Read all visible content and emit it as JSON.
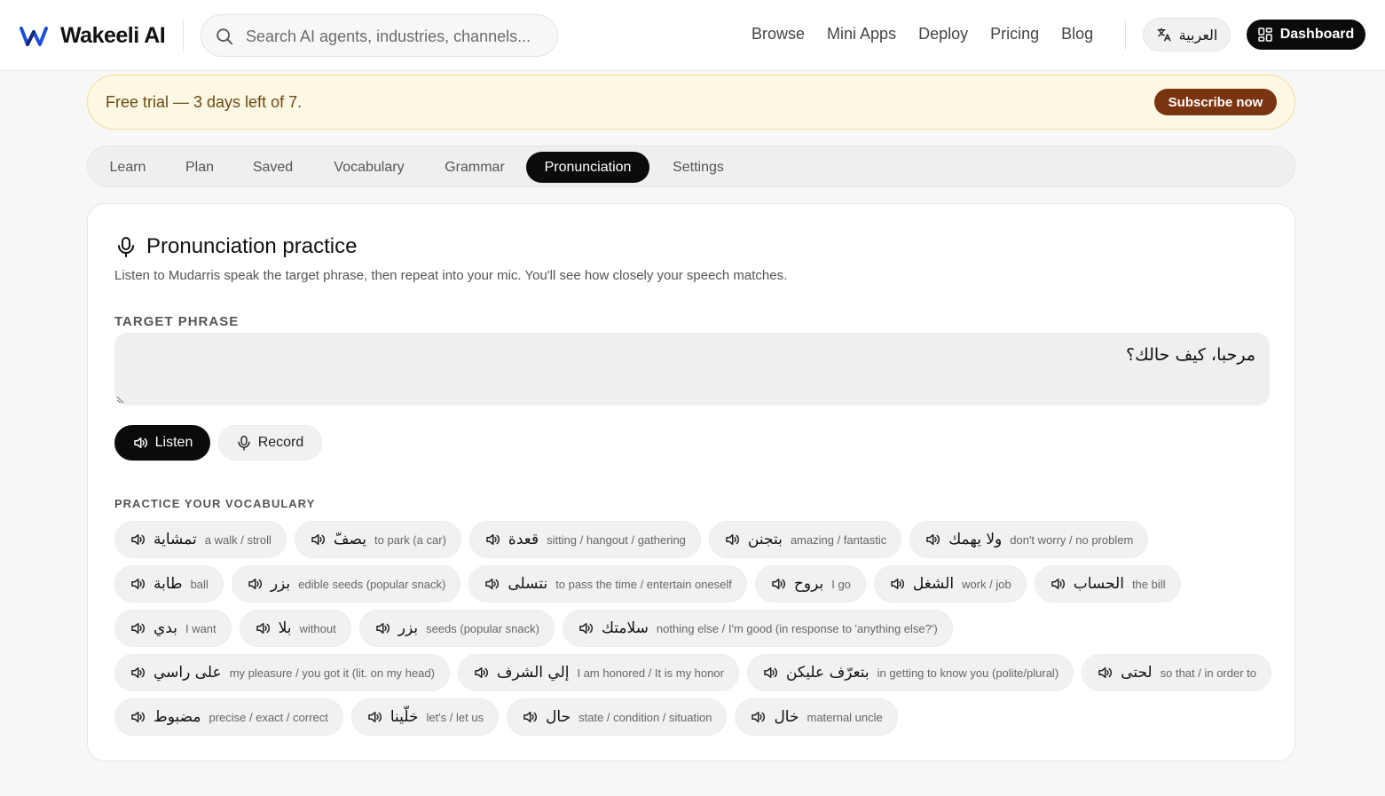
{
  "header": {
    "logo_text": "Wakeeli AI",
    "search_placeholder": "Search AI agents, industries, channels...",
    "nav": [
      "Browse",
      "Mini Apps",
      "Deploy",
      "Pricing",
      "Blog"
    ],
    "lang_label": "العربية",
    "dashboard_label": "Dashboard"
  },
  "banner": {
    "text": "Free trial — 3 days left of 7.",
    "subscribe_label": "Subscribe now"
  },
  "tabs": [
    "Learn",
    "Plan",
    "Saved",
    "Vocabulary",
    "Grammar",
    "Pronunciation",
    "Settings"
  ],
  "active_tab": "Pronunciation",
  "practice": {
    "title": "Pronunciation practice",
    "description": "Listen to Mudarris speak the target phrase, then repeat into your mic. You'll see how closely your speech matches.",
    "target_label": "TARGET PHRASE",
    "target_phrase": "مرحبا، كيف حالك؟",
    "listen_label": "Listen",
    "record_label": "Record",
    "vocab_label": "PRACTICE YOUR VOCABULARY"
  },
  "vocab_rows": [
    [
      {
        "ar": "تمشاية",
        "en": "a walk / stroll"
      },
      {
        "ar": "يصفّ",
        "en": "to park (a car)"
      },
      {
        "ar": "قعدة",
        "en": "sitting / hangout / gathering"
      },
      {
        "ar": "بتجنن",
        "en": "amazing / fantastic"
      },
      {
        "ar": "ولا يهمك",
        "en": "don't worry / no problem"
      }
    ],
    [
      {
        "ar": "طابة",
        "en": "ball"
      },
      {
        "ar": "بزر",
        "en": "edible seeds (popular snack)"
      },
      {
        "ar": "نتسلى",
        "en": "to pass the time / entertain oneself"
      },
      {
        "ar": "بروح",
        "en": "I go"
      },
      {
        "ar": "الشغل",
        "en": "work / job"
      },
      {
        "ar": "الحساب",
        "en": "the bill"
      }
    ],
    [
      {
        "ar": "بدي",
        "en": "I want"
      },
      {
        "ar": "بلا",
        "en": "without"
      },
      {
        "ar": "بزر",
        "en": "seeds (popular snack)"
      },
      {
        "ar": "سلامتك",
        "en": "nothing else / I'm good (in response to 'anything else?')"
      }
    ],
    [
      {
        "ar": "على راسي",
        "en": "my pleasure / you got it (lit. on my head)"
      },
      {
        "ar": "إلي الشرف",
        "en": "I am honored / It is my honor"
      },
      {
        "ar": "بتعرّف عليكن",
        "en": "in getting to know you (polite/plural)"
      },
      {
        "ar": "لحتى",
        "en": "so that / in order to"
      }
    ],
    [
      {
        "ar": "مضبوط",
        "en": "precise / exact / correct"
      },
      {
        "ar": "خلّينا",
        "en": "let's / let us"
      },
      {
        "ar": "حال",
        "en": "state / condition / situation"
      },
      {
        "ar": "خال",
        "en": "maternal uncle"
      }
    ]
  ]
}
